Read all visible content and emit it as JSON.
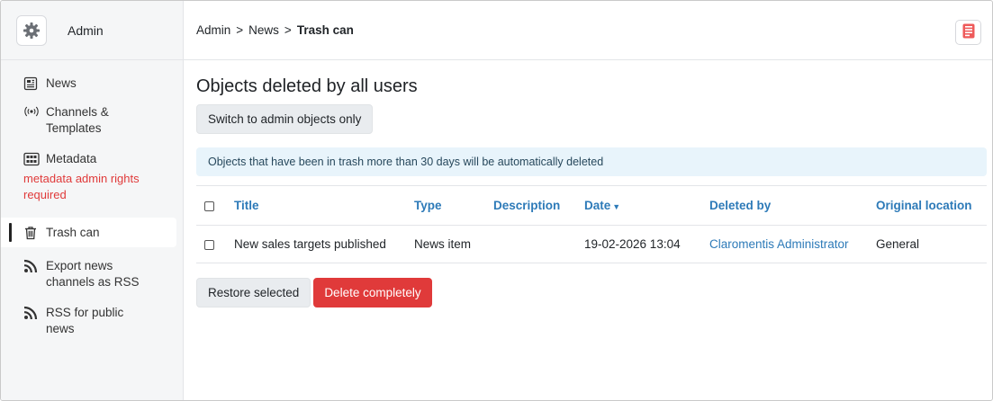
{
  "sidebar": {
    "title": "Admin",
    "items": [
      {
        "label": "News",
        "icon": "newspaper-icon"
      },
      {
        "label": "Channels & Templates",
        "icon": "broadcast-icon"
      },
      {
        "label": "Metadata",
        "sub": "metadata admin rights required",
        "icon": "metadata-icon"
      },
      {
        "label": "Trash can",
        "icon": "trash-icon",
        "active": true
      },
      {
        "label": "Export news channels as RSS",
        "icon": "rss-icon"
      },
      {
        "label": "RSS for public news",
        "icon": "rss-icon"
      }
    ]
  },
  "breadcrumb": {
    "part1": "Admin",
    "part2": "News",
    "current": "Trash can",
    "separator": ">"
  },
  "main": {
    "heading": "Objects deleted by all users",
    "switch_label": "Switch to admin objects only",
    "info": "Objects that have been in trash more than 30 days will be automatically deleted"
  },
  "table": {
    "headers": {
      "title": "Title",
      "type": "Type",
      "description": "Description",
      "date": "Date",
      "deleted_by": "Deleted by",
      "location": "Original location"
    },
    "rows": [
      {
        "title": "New sales targets published",
        "type": "News item",
        "description": "",
        "date": "19-02-2026 13:04",
        "deleted_by": "Claromentis Administrator",
        "location": "General"
      }
    ]
  },
  "actions": {
    "restore_label": "Restore selected",
    "delete_label": "Delete completely"
  },
  "colors": {
    "accent": "#2d7ab8",
    "danger": "#e03a3a",
    "info_bg": "#e8f4fb"
  }
}
